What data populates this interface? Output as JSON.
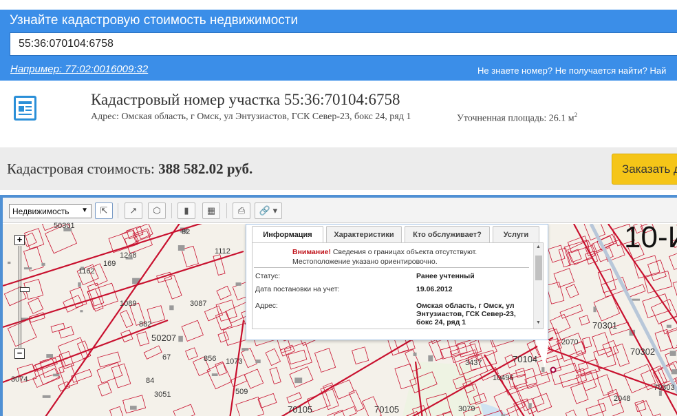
{
  "search": {
    "title": "Узнайте кадастровую стоимость недвижимости",
    "input_value": "55:36:070104:6758",
    "example_link": "Например: 77:02:0016009:32",
    "help_link": "Не знаете номер? Не получается найти? Най"
  },
  "parcel": {
    "title": "Кадастровый номер участка 55:36:70104:6758",
    "address": "Адрес: Омская область, г Омск, ул Энтузиастов, ГСК Север-23, бокс 24, ряд 1",
    "area_label": "Уточненная площадь: 26.1 м",
    "area_sup": "2"
  },
  "cost": {
    "label": "Кадастровая стоимость: ",
    "value": "388 582.02 руб.",
    "order_button": "Заказать д"
  },
  "toolbar": {
    "layer_select": "Недвижимость",
    "tools": [
      "select-tool-icon",
      "measure-length-icon",
      "measure-area-icon",
      "ruler-icon",
      "ruler-area-icon",
      "print-icon",
      "link-icon"
    ]
  },
  "map": {
    "zoom_in": "+",
    "zoom_out": "−",
    "district_label": "10-И",
    "labels": {
      "l_50301": "50301",
      "l_82": "82",
      "l_1112": "1112",
      "l_1162": "1162",
      "l_169": "169",
      "l_1248": "1248",
      "l_1089": "1089",
      "l_3087": "3087",
      "l_882": "882",
      "l_50207": "50207",
      "l_67": "67",
      "l_856": "856",
      "l_1073": "1073",
      "l_3074": "3074",
      "l_84": "84",
      "l_3051": "3051",
      "l_509": "509",
      "l_70105": "70105",
      "l_3079": "3079",
      "l_70104": "70104",
      "l_3437": "3437",
      "l_10496": "10496",
      "l_70301": "70301",
      "l_70302": "70302",
      "l_2070": "2070",
      "l_2048": "2048",
      "l_70303": "70303",
      "l_70105b": "70105"
    }
  },
  "popup": {
    "tabs": [
      "Информация",
      "Характеристики",
      "Кто обслуживает?",
      "Услуги"
    ],
    "warning_label": "Внимание!",
    "warning_text": " Сведения о границах объекта отсутствуют. Местоположение указано ориентировочно.",
    "rows": [
      {
        "label": "Статус:",
        "value": "Ранее учтенный"
      },
      {
        "label": "Дата постановки на учет:",
        "value": "19.06.2012"
      },
      {
        "label": "Адрес:",
        "value": "Омская область, г Омск, ул Энтузиастов, ГСК Север-23, бокс 24, ряд 1"
      }
    ]
  },
  "colors": {
    "banner": "#3b8ee8",
    "cadastre_lines": "#c8102e",
    "order_button": "#f5c518",
    "warning": "#c0141c"
  }
}
